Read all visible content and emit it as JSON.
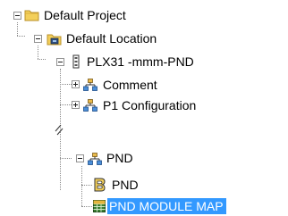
{
  "tree": {
    "items": [
      {
        "label": "Default Project",
        "icon": "folder-icon",
        "expanded": true
      },
      {
        "label": "Default Location",
        "icon": "location-folder-icon",
        "expanded": true
      },
      {
        "label": "PLX31 -mmm-PND",
        "icon": "device-icon",
        "expanded": true
      },
      {
        "label": "Comment",
        "icon": "network-tree-icon",
        "expanded": false
      },
      {
        "label": "P1 Configuration",
        "icon": "network-tree-icon",
        "expanded": false
      },
      {
        "label": "PND",
        "icon": "network-tree-icon",
        "expanded": true
      },
      {
        "label": "PND",
        "icon": "module-b-icon"
      },
      {
        "label": "PND MODULE MAP",
        "icon": "grid-table-icon",
        "selected": true
      }
    ]
  },
  "colors": {
    "selection": "#3399ff",
    "folder": "#f3cf5a",
    "tree_lines": "#8a8a8a"
  }
}
